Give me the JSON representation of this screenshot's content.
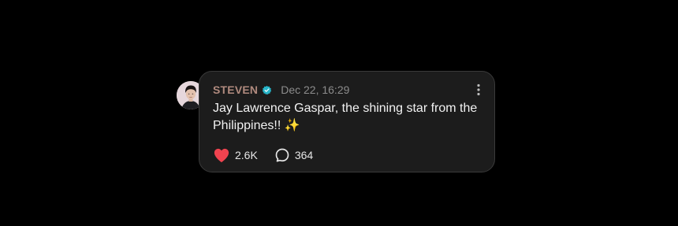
{
  "post": {
    "author": {
      "name": "STEVEN",
      "verified_icon": "verified-badge-icon",
      "verified_color": "#27b5c9"
    },
    "timestamp": "Dec 22, 16:29",
    "text": "Jay Lawrence Gaspar, the shining star from the Philippines!! ✨",
    "likes": {
      "count": "2.6K",
      "icon": "heart-icon",
      "color": "#f0434f"
    },
    "comments": {
      "count": "364",
      "icon": "comment-bubble-icon"
    },
    "menu_icon": "more-vertical-icon"
  },
  "colors": {
    "background": "#000000",
    "card": "#1c1c1c",
    "username": "#b08a7e",
    "timestamp": "#8c8c8c",
    "text": "#f2f2f2"
  }
}
